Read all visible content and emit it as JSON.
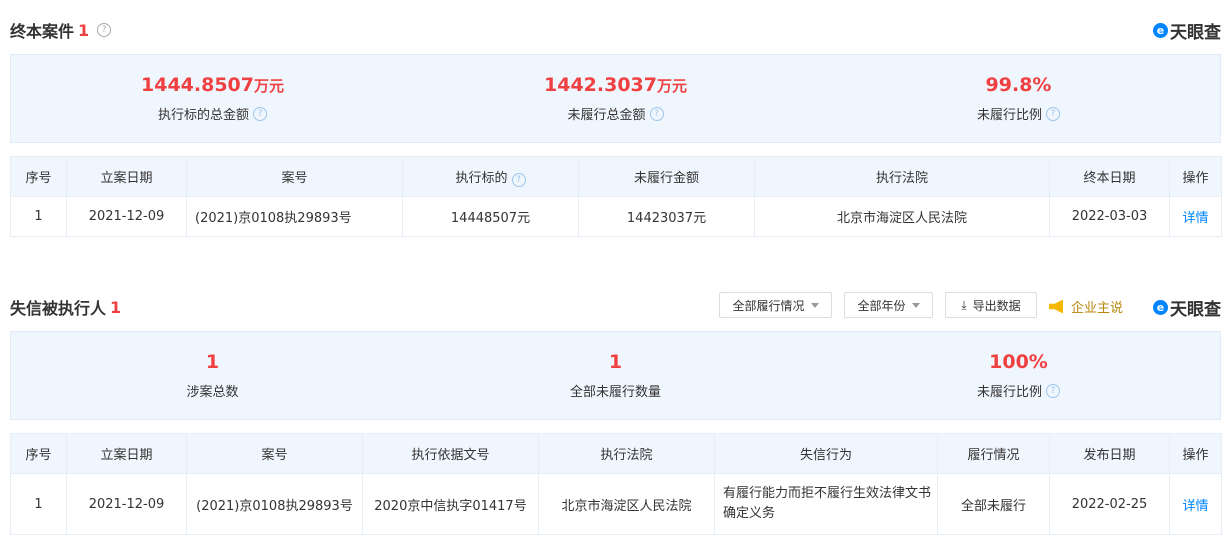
{
  "section1": {
    "title": "终本案件",
    "count": "1",
    "logo": "天眼查",
    "summary": [
      {
        "value": "1444.8507",
        "unit": "万元",
        "label": "执行标的总金额"
      },
      {
        "value": "1442.3037",
        "unit": "万元",
        "label": "未履行总金额"
      },
      {
        "value": "99.8%",
        "unit": "",
        "label": "未履行比例"
      }
    ],
    "headers": [
      "序号",
      "立案日期",
      "案号",
      "执行标的",
      "未履行金额",
      "执行法院",
      "终本日期",
      "操作"
    ],
    "rows": [
      [
        "1",
        "2021-12-09",
        "(2021)京0108执29893号",
        "14448507元",
        "14423037元",
        "北京市海淀区人民法院",
        "2022-03-03",
        "详情"
      ]
    ]
  },
  "section2": {
    "title": "失信被执行人",
    "count": "1",
    "logo": "天眼查",
    "filters": [
      "全部履行情况",
      "全部年份"
    ],
    "export": "导出数据",
    "company_say": "企业主说",
    "summary": [
      {
        "value": "1",
        "label": "涉案总数"
      },
      {
        "value": "1",
        "label": "全部未履行数量"
      },
      {
        "value": "100%",
        "label": "未履行比例"
      }
    ],
    "headers": [
      "序号",
      "立案日期",
      "案号",
      "执行依据文号",
      "执行法院",
      "失信行为",
      "履行情况",
      "发布日期",
      "操作"
    ],
    "rows": [
      [
        "1",
        "2021-12-09",
        "(2021)京0108执29893号",
        "2020京中信执字01417号",
        "北京市海淀区人民法院",
        "有履行能力而拒不履行生效法律文书确定义务",
        "全部未履行",
        "2022-02-25",
        "详情"
      ]
    ]
  }
}
